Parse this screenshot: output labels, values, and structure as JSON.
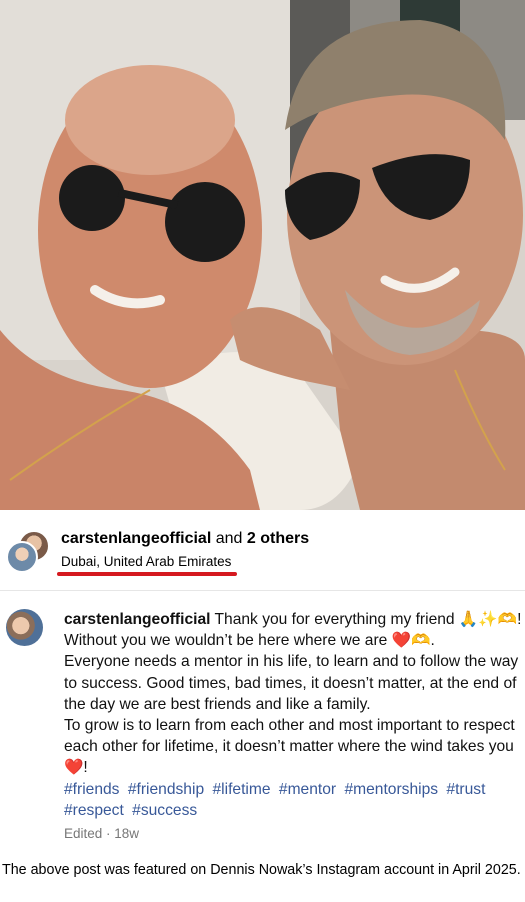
{
  "post": {
    "image_alt": "Two men in sunglasses taking a selfie",
    "owner": "carstenlangeofficial",
    "coauthors_prefix": "and",
    "coauthors_count": "2 others",
    "location": "Dubai, United Arab Emirates"
  },
  "caption": {
    "username": "carstenlangeofficial",
    "p1": " Thank you for everything my friend 🙏✨🫶! Without you we wouldn’t be here where we are ❤️🫶.",
    "p2": "Everyone needs a mentor in his life, to learn and to follow the way to success. Good times, bad times, it doesn’t matter, at the end of the day we are best friends and like a family.",
    "p3": "To grow is to learn from each other and most important to respect each other for lifetime, it doesn’t matter where the wind takes you ❤️!",
    "hashtags": [
      "#friends",
      "#friendship",
      "#lifetime",
      "#mentor",
      "#mentorships",
      "#trust",
      "#respect",
      "#success"
    ],
    "meta": "Edited · 18w"
  },
  "footnote": "The above post was featured on Dennis Nowak’s Instagram account in April 2025.",
  "colors": {
    "underline": "#d5191f",
    "hashtag": "#385898"
  }
}
